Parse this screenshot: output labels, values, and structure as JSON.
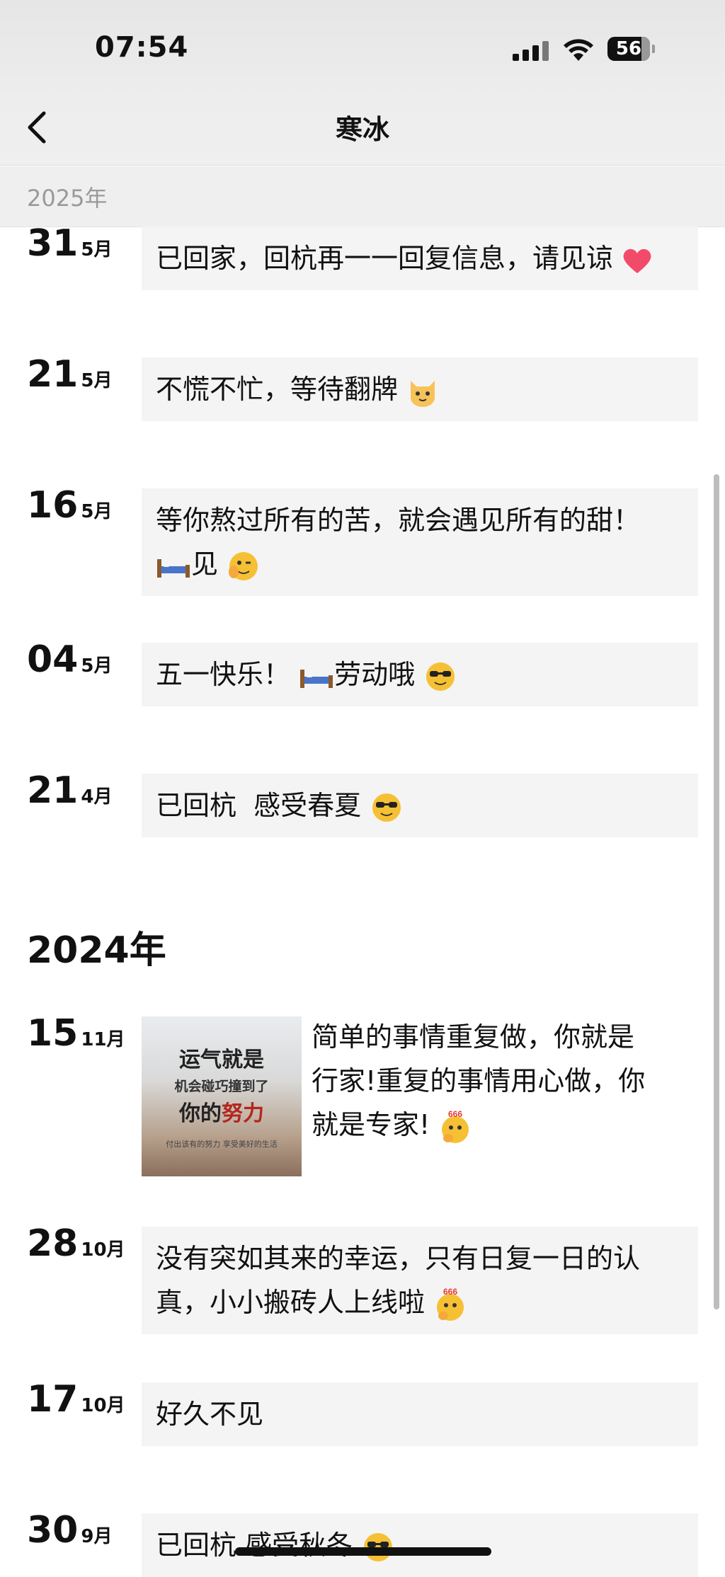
{
  "status_bar": {
    "time": "07:54",
    "battery": "56"
  },
  "nav": {
    "title": "寒冰",
    "back_icon": "chevron-left-icon"
  },
  "sticky_year": "2025年",
  "posts_2025": [
    {
      "day": "31",
      "month": "5月",
      "text": "已回家，回杭再一一回复信息，请见谅",
      "emoji": "heart"
    },
    {
      "day": "21",
      "month": "5月",
      "text": "不慌不忙，等待翻牌",
      "emoji": "cat-face"
    },
    {
      "day": "16",
      "month": "5月",
      "text_line1": "等你熬过所有的苦，就会遇见所有的甜！",
      "text_line2": "见",
      "emoji": "bed, wink"
    },
    {
      "day": "04",
      "month": "5月",
      "text_a": "五一快乐！",
      "text_b": "劳动哦",
      "emoji": "bed, sunglasses"
    },
    {
      "day": "21",
      "month": "4月",
      "text": "已回杭  感受春夏",
      "emoji": "sunglasses"
    }
  ],
  "year_2024": "2024年",
  "posts_2024": [
    {
      "day": "15",
      "month": "11月",
      "image": {
        "line1": "运气就是",
        "line2": "机会碰巧撞到了",
        "line3a": "你的",
        "line3b": "努力",
        "line4": "付出该有的努力  享受美好的生活"
      },
      "text_line1": "简单的事情重复做，你就是",
      "text_line2": "行家!重复的事情用心做，你",
      "text_line3": "就是专家!",
      "emoji": "666-thinking"
    },
    {
      "day": "28",
      "month": "10月",
      "text_line1": "没有突如其来的幸运，只有日复一日的认",
      "text_line2": "真，小小搬砖人上线啦",
      "emoji": "666-thinking"
    },
    {
      "day": "17",
      "month": "10月",
      "text": "好久不见"
    },
    {
      "day": "30",
      "month": "9月",
      "text": "已回杭 感受秋冬",
      "emoji": "sunglasses"
    }
  ],
  "colors": {
    "bubble_bg": "#f4f4f4",
    "top_bg": "#ececec",
    "year_sticky_text": "#9a9a9a"
  }
}
